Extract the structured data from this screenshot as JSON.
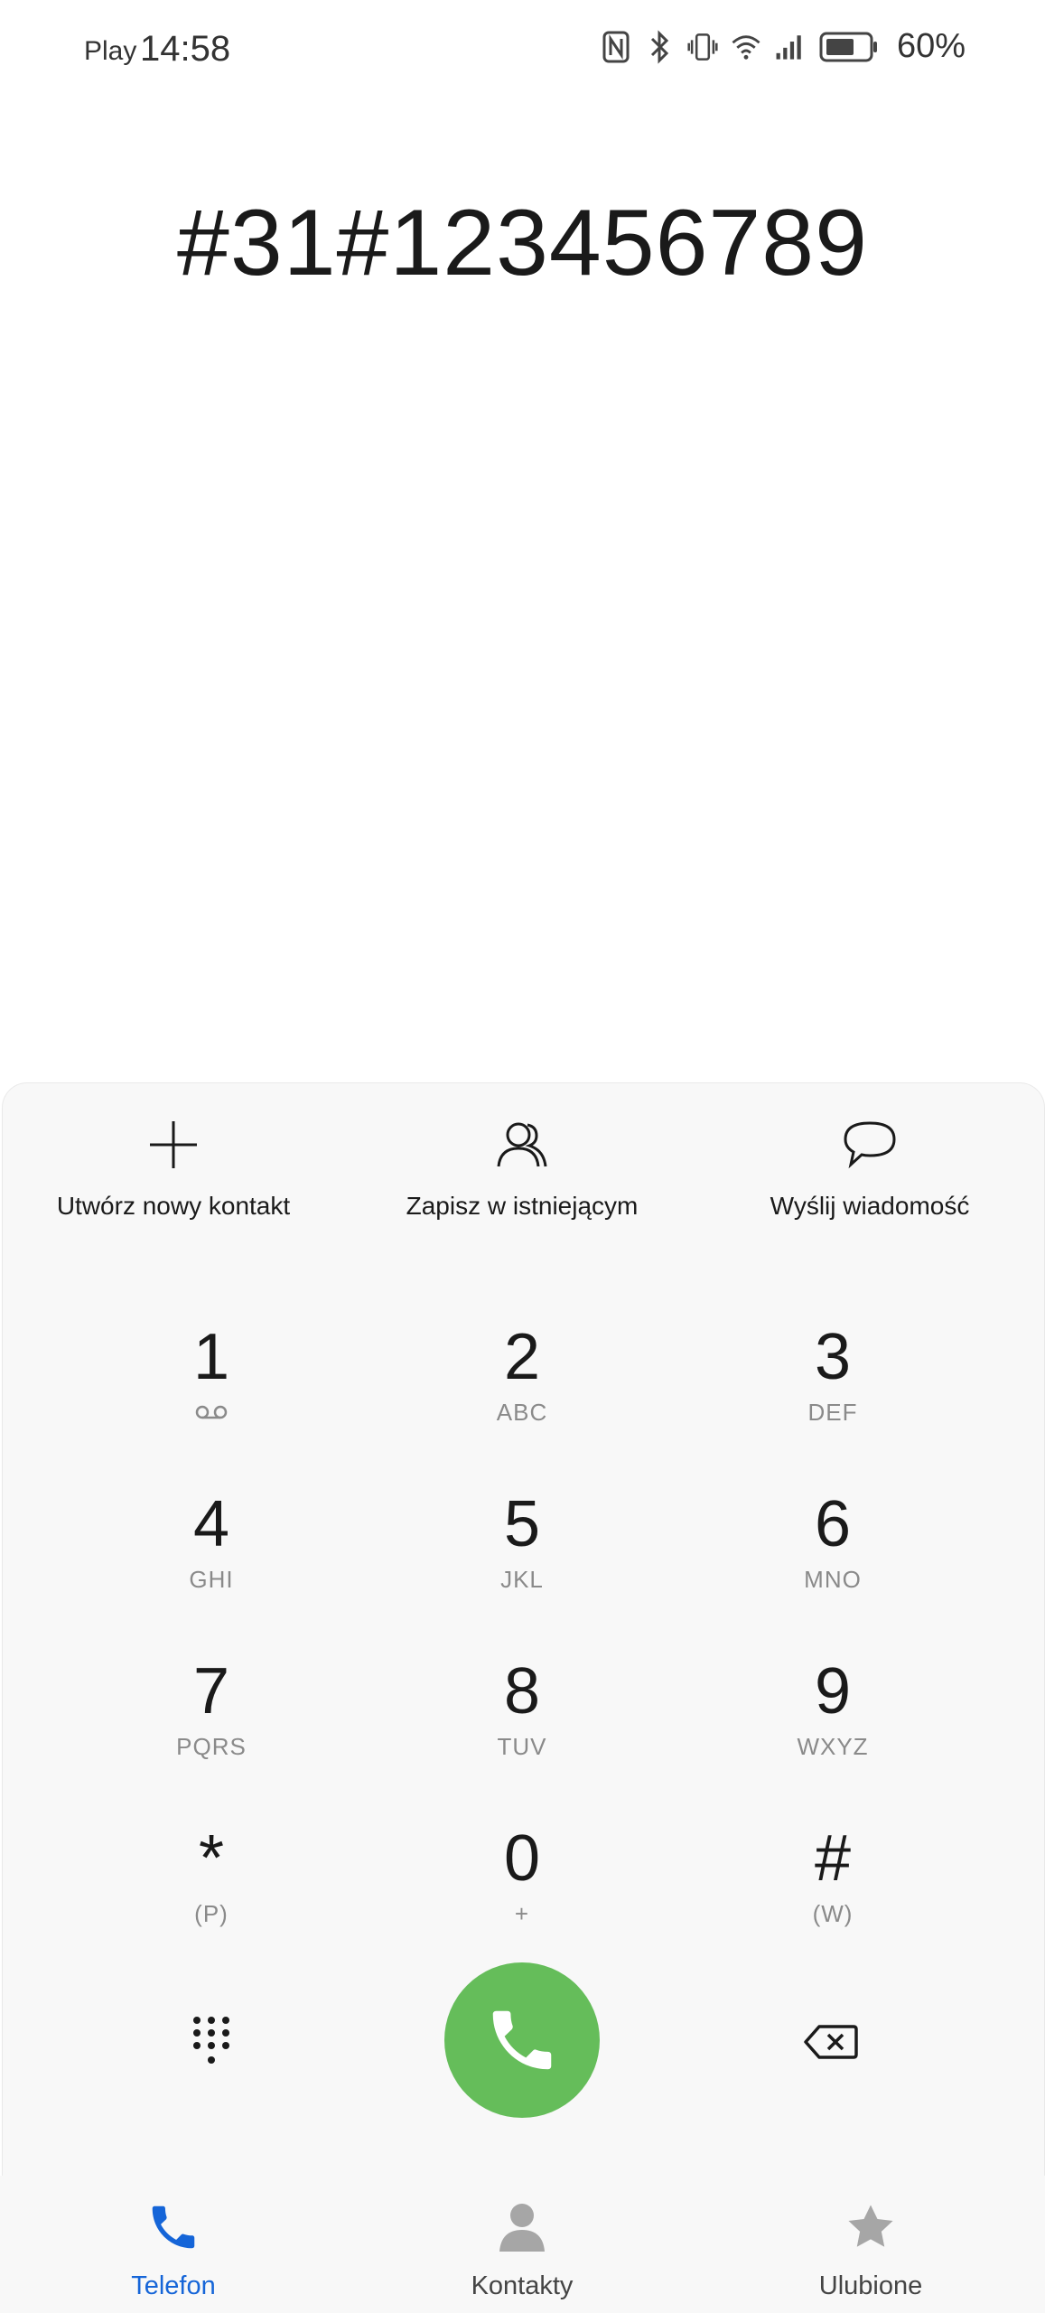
{
  "status_bar": {
    "carrier": "Play",
    "time": "14:58",
    "battery_percent": "60%",
    "icons": [
      "nfc-icon",
      "bluetooth-icon",
      "vibrate-icon",
      "wifi-icon",
      "signal-icon",
      "battery-icon"
    ]
  },
  "dialer": {
    "number": "#31#123456789"
  },
  "actions": [
    {
      "label": "Utwórz nowy kontakt",
      "icon": "plus-icon"
    },
    {
      "label": "Zapisz w istniejącym",
      "icon": "contact-icon"
    },
    {
      "label": "Wyślij wiadomość",
      "icon": "message-icon"
    }
  ],
  "keypad": [
    {
      "digit": "1",
      "letters": "",
      "sub_icon": "voicemail-icon"
    },
    {
      "digit": "2",
      "letters": "ABC"
    },
    {
      "digit": "3",
      "letters": "DEF"
    },
    {
      "digit": "4",
      "letters": "GHI"
    },
    {
      "digit": "5",
      "letters": "JKL"
    },
    {
      "digit": "6",
      "letters": "MNO"
    },
    {
      "digit": "7",
      "letters": "PQRS"
    },
    {
      "digit": "8",
      "letters": "TUV"
    },
    {
      "digit": "9",
      "letters": "WXYZ"
    },
    {
      "digit": "*",
      "letters": "(P)"
    },
    {
      "digit": "0",
      "letters": "+"
    },
    {
      "digit": "#",
      "letters": "(W)"
    }
  ],
  "bottom_nav": [
    {
      "label": "Telefon",
      "icon": "phone-icon",
      "active": true
    },
    {
      "label": "Kontakty",
      "icon": "person-icon",
      "active": false
    },
    {
      "label": "Ulubione",
      "icon": "star-icon",
      "active": false
    }
  ],
  "colors": {
    "call_button": "#65bd5a",
    "active_tab": "#1565d8",
    "inactive_icon": "#a6a6a6"
  }
}
